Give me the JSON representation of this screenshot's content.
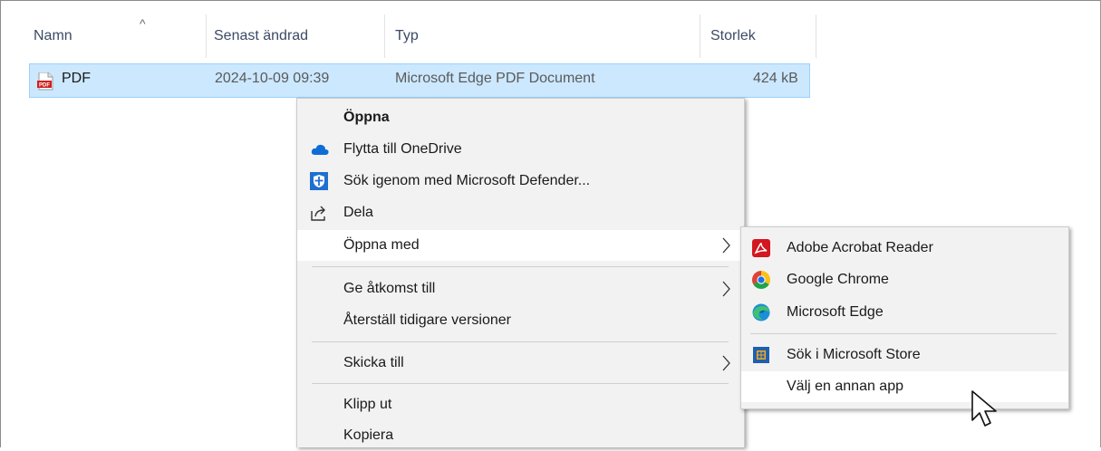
{
  "columns": {
    "name": "Namn",
    "modified": "Senast ändrad",
    "type": "Typ",
    "size": "Storlek"
  },
  "file": {
    "name": "PDF",
    "modified": "2024-10-09 09:39",
    "type": "Microsoft Edge PDF Document",
    "size": "424 kB"
  },
  "context_menu": {
    "open": "Öppna",
    "move_onedrive": "Flytta till OneDrive",
    "scan_defender": "Sök igenom med Microsoft Defender...",
    "share": "Dela",
    "open_with": "Öppna med",
    "give_access": "Ge åtkomst till",
    "restore_versions": "Återställ tidigare versioner",
    "send_to": "Skicka till",
    "cut": "Klipp ut",
    "copy": "Kopiera"
  },
  "open_with_menu": {
    "acrobat": "Adobe Acrobat Reader",
    "chrome": "Google Chrome",
    "edge": "Microsoft Edge",
    "store": "Sök i Microsoft Store",
    "other_app": "Välj en annan app"
  },
  "colors": {
    "selection": "#cce8ff",
    "menu_bg": "#f2f2f2",
    "header_text": "#3c4a66"
  }
}
